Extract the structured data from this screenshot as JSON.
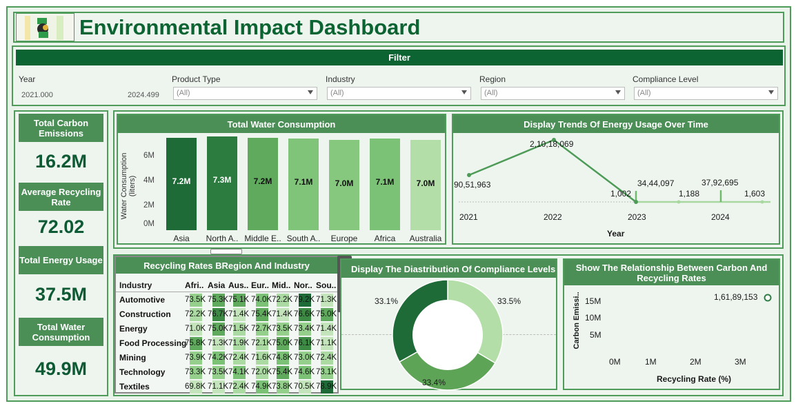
{
  "title": "Environmental Impact Dashboard",
  "filter": {
    "header": "Filter",
    "year": {
      "label": "Year",
      "min": "2021.000",
      "max": "2024.499"
    },
    "dropdowns": [
      {
        "label": "Product Type",
        "value": "(All)"
      },
      {
        "label": "Industry",
        "value": "(All)"
      },
      {
        "label": "Region",
        "value": "(All)"
      },
      {
        "label": "Compliance Level",
        "value": "(All)"
      }
    ]
  },
  "kpis": [
    {
      "label": "Total Carbon Emissions",
      "value": "16.2M"
    },
    {
      "label": "Average Recycling Rate",
      "value": "72.02"
    },
    {
      "label": "Total Energy Usage",
      "value": "37.5M"
    },
    {
      "label": "Total Water Consumption",
      "value": "49.9M"
    }
  ],
  "water_chart": {
    "title": "Total Water Consumption",
    "ylabel": "Water Consumption (liters)",
    "ticks": [
      "0M",
      "2M",
      "4M",
      "6M"
    ],
    "bars": [
      {
        "cat": "Asia",
        "label": "7.2M",
        "value": 7.2,
        "color": "#1f6b37"
      },
      {
        "cat": "North A..",
        "label": "7.3M",
        "value": 7.3,
        "color": "#2c7b3f"
      },
      {
        "cat": "Middle E..",
        "label": "7.2M",
        "value": 7.2,
        "color": "#5faa5c"
      },
      {
        "cat": "South A..",
        "label": "7.1M",
        "value": 7.1,
        "color": "#80c47a"
      },
      {
        "cat": "Europe",
        "label": "7.0M",
        "value": 7.0,
        "color": "#86c87d"
      },
      {
        "cat": "Africa",
        "label": "7.1M",
        "value": 7.1,
        "color": "#7cc276"
      },
      {
        "cat": "Australia",
        "label": "7.0M",
        "value": 7.0,
        "color": "#b3dea8"
      }
    ]
  },
  "energy_chart": {
    "title": "Display Trends Of Energy Usage Over Time",
    "xlabel": "Year",
    "xticks": [
      "2021",
      "2022",
      "2023",
      "2024"
    ],
    "labels": [
      "90,51,963",
      "2,10,18,069",
      "1,002",
      "34,44,097",
      "1,188",
      "37,92,695",
      "1,603"
    ]
  },
  "recycling_table": {
    "title": "Recycling Rates BRegion And Industry",
    "row_header": "Industry",
    "columns": [
      "Afri..",
      "Asia",
      "Aus..",
      "Eur..",
      "Mid..",
      "Nor..",
      "Sou.."
    ],
    "rows": [
      {
        "name": "Automotive",
        "cells": [
          "73.5K",
          "75.3K",
          "75.1K",
          "74.0K",
          "72.2K",
          "79.2K",
          "71.3K"
        ]
      },
      {
        "name": "Construction",
        "cells": [
          "72.2K",
          "76.7K",
          "71.4K",
          "75.4K",
          "71.4K",
          "76.6K",
          "75.0K"
        ]
      },
      {
        "name": "Energy",
        "cells": [
          "71.0K",
          "75.0K",
          "71.5K",
          "72.7K",
          "73.5K",
          "73.4K",
          "71.4K"
        ]
      },
      {
        "name": "Food Processing",
        "cells": [
          "75.8K",
          "71.3K",
          "71.9K",
          "72.1K",
          "75.0K",
          "76.1K",
          "71.1K"
        ]
      },
      {
        "name": "Mining",
        "cells": [
          "73.9K",
          "74.2K",
          "72.4K",
          "71.6K",
          "74.8K",
          "73.0K",
          "72.4K"
        ]
      },
      {
        "name": "Technology",
        "cells": [
          "73.3K",
          "73.5K",
          "74.1K",
          "72.0K",
          "75.4K",
          "74.6K",
          "73.1K"
        ]
      },
      {
        "name": "Textiles",
        "cells": [
          "69.8K",
          "71.1K",
          "72.4K",
          "74.9K",
          "73.8K",
          "70.5K",
          "78.9K"
        ]
      }
    ]
  },
  "compliance_chart": {
    "title": "Display The Diastribution Of Compliance Levels",
    "slices": [
      {
        "label": "33.5%",
        "value": 33.5,
        "color": "#b3dea8"
      },
      {
        "label": "33.4%",
        "value": 33.4,
        "color": "#5ea457"
      },
      {
        "label": "33.1%",
        "value": 33.1,
        "color": "#1f6b37"
      }
    ]
  },
  "scatter_chart": {
    "title": "Show The Relationship Between Carbon And Recycling Rates",
    "xlabel": "Recycling Rate (%)",
    "ylabel": "Carbon Emissi..",
    "xticks": [
      "0M",
      "1M",
      "2M",
      "3M"
    ],
    "yticks": [
      "5M",
      "10M",
      "15M"
    ],
    "point_label": "1,61,89,153"
  },
  "icons": {
    "close": "×",
    "popout": "⧉",
    "filter": "⏷",
    "more": "▾"
  },
  "chart_data": [
    {
      "type": "bar",
      "title": "Total Water Consumption",
      "ylabel": "Water Consumption (liters)",
      "categories": [
        "Asia",
        "North A..",
        "Middle E..",
        "South A..",
        "Europe",
        "Africa",
        "Australia"
      ],
      "values": [
        7.2,
        7.3,
        7.2,
        7.1,
        7.0,
        7.1,
        7.0
      ],
      "value_labels": [
        "7.2M",
        "7.3M",
        "7.2M",
        "7.1M",
        "7.0M",
        "7.1M",
        "7.0M"
      ],
      "ylim": [
        0,
        7.5
      ],
      "unit": "M"
    },
    {
      "type": "line",
      "title": "Display Trends Of Energy Usage Over Time",
      "xlabel": "Year",
      "series": [
        {
          "x": [
            2021.0,
            2022.0,
            2023.0
          ],
          "y": [
            9051963,
            21018069,
            1002
          ]
        },
        {
          "x": [
            2023.0,
            2024.0
          ],
          "y": [
            3444097,
            3792695
          ]
        },
        {
          "x": [
            2023.5,
            2024.5
          ],
          "y": [
            1188,
            1603
          ]
        }
      ]
    },
    {
      "type": "pie",
      "title": "Display The Diastribution Of Compliance Levels",
      "values": [
        33.5,
        33.4,
        33.1
      ]
    },
    {
      "type": "scatter",
      "title": "Show The Relationship Between Carbon And Recycling Rates",
      "xlabel": "Recycling Rate (%)",
      "ylabel": "Carbon Emissi..",
      "x": [
        3.6
      ],
      "y": [
        16189153
      ],
      "xlim": [
        0,
        3.8
      ],
      "ylim": [
        0,
        18
      ]
    }
  ]
}
